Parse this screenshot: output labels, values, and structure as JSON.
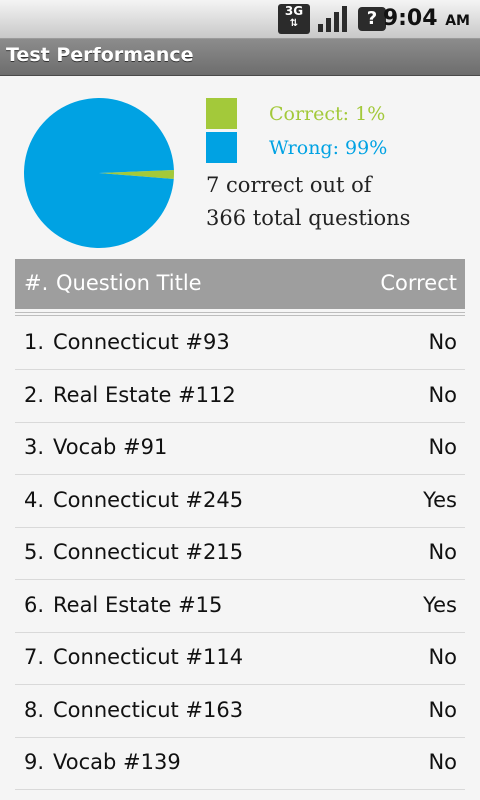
{
  "status_bar": {
    "network": "3G",
    "time": "9:04",
    "ampm": "AM"
  },
  "title_bar": {
    "title": "Test Performance"
  },
  "chart": {
    "correct_color": "#a3c93a",
    "wrong_color": "#00a2e3",
    "legend_correct": "Correct: 1%",
    "legend_wrong": "Wrong: 99%",
    "summary_line1": "7 correct out of",
    "summary_line2": "366 total questions"
  },
  "chart_data": {
    "type": "pie",
    "labels": [
      "Correct",
      "Wrong"
    ],
    "values": [
      7,
      359
    ]
  },
  "table": {
    "headers": {
      "num": "#.",
      "title": "Question Title",
      "correct": "Correct"
    },
    "rows": [
      {
        "num": "1.",
        "title": "Connecticut #93",
        "correct": "No"
      },
      {
        "num": "2.",
        "title": "Real Estate #112",
        "correct": "No"
      },
      {
        "num": "3.",
        "title": "Vocab #91",
        "correct": "No"
      },
      {
        "num": "4.",
        "title": "Connecticut #245",
        "correct": "Yes"
      },
      {
        "num": "5.",
        "title": "Connecticut #215",
        "correct": "No"
      },
      {
        "num": "6.",
        "title": "Real Estate #15",
        "correct": "Yes"
      },
      {
        "num": "7.",
        "title": "Connecticut #114",
        "correct": "No"
      },
      {
        "num": "8.",
        "title": "Connecticut #163",
        "correct": "No"
      },
      {
        "num": "9.",
        "title": "Vocab #139",
        "correct": "No"
      }
    ]
  }
}
